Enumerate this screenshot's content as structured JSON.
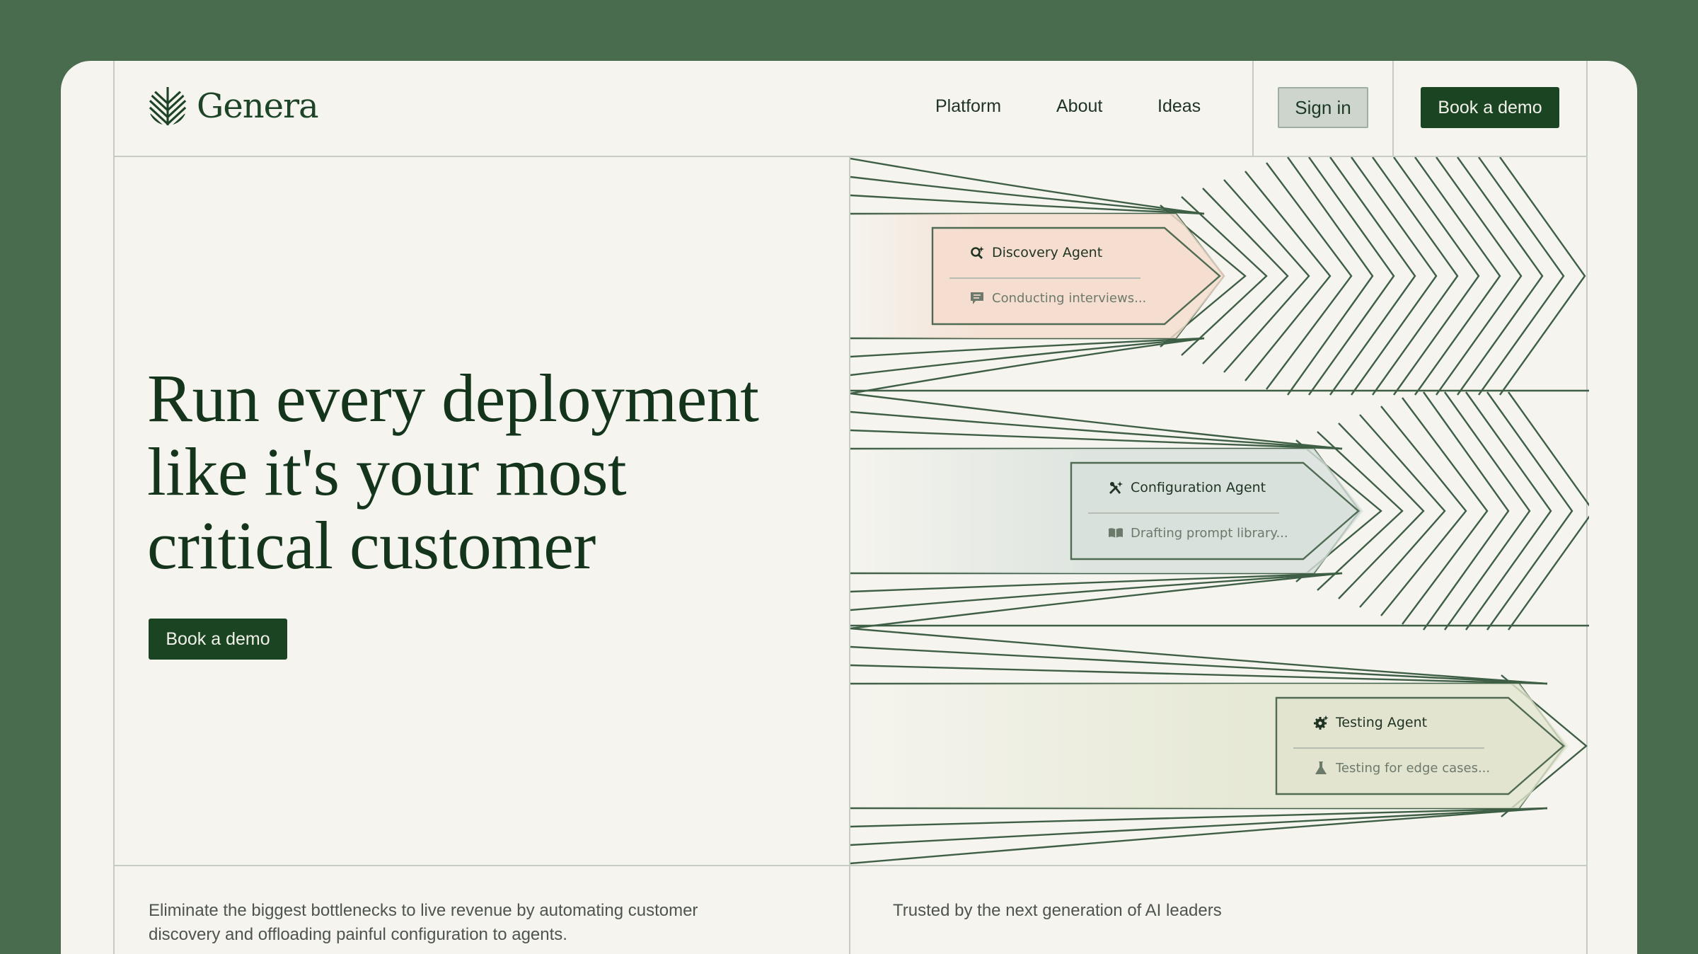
{
  "brand": {
    "name": "Genera"
  },
  "nav": {
    "links": [
      "Platform",
      "About",
      "Ideas"
    ],
    "signin_label": "Sign in",
    "demo_label": "Book a demo"
  },
  "hero": {
    "headline_lines": [
      "Run every deployment",
      "like it's your most",
      "critical customer"
    ],
    "cta_label": "Book a demo"
  },
  "agents": [
    {
      "title": "Discovery Agent",
      "status": "Conducting interviews...",
      "title_icon": "search-sparkle-icon",
      "status_icon": "chat-icon",
      "color": "#f5ddcf"
    },
    {
      "title": "Configuration Agent",
      "status": "Drafting prompt library...",
      "title_icon": "wrench-sparkle-icon",
      "status_icon": "book-icon",
      "color": "#d9e1dc"
    },
    {
      "title": "Testing Agent",
      "status": "Testing for edge cases...",
      "title_icon": "gear-icon",
      "status_icon": "flask-icon",
      "color": "#e2e4cf"
    }
  ],
  "footer": {
    "description_line1": "Eliminate the biggest bottlenecks to live revenue by automating customer",
    "description_line2": "discovery and offloading painful configuration to agents.",
    "trusted": "Trusted by the next generation of AI leaders"
  },
  "colors": {
    "frame": "#496c4f",
    "page": "#f5f4ee",
    "primary": "#1b4422",
    "text": "#14351c"
  }
}
